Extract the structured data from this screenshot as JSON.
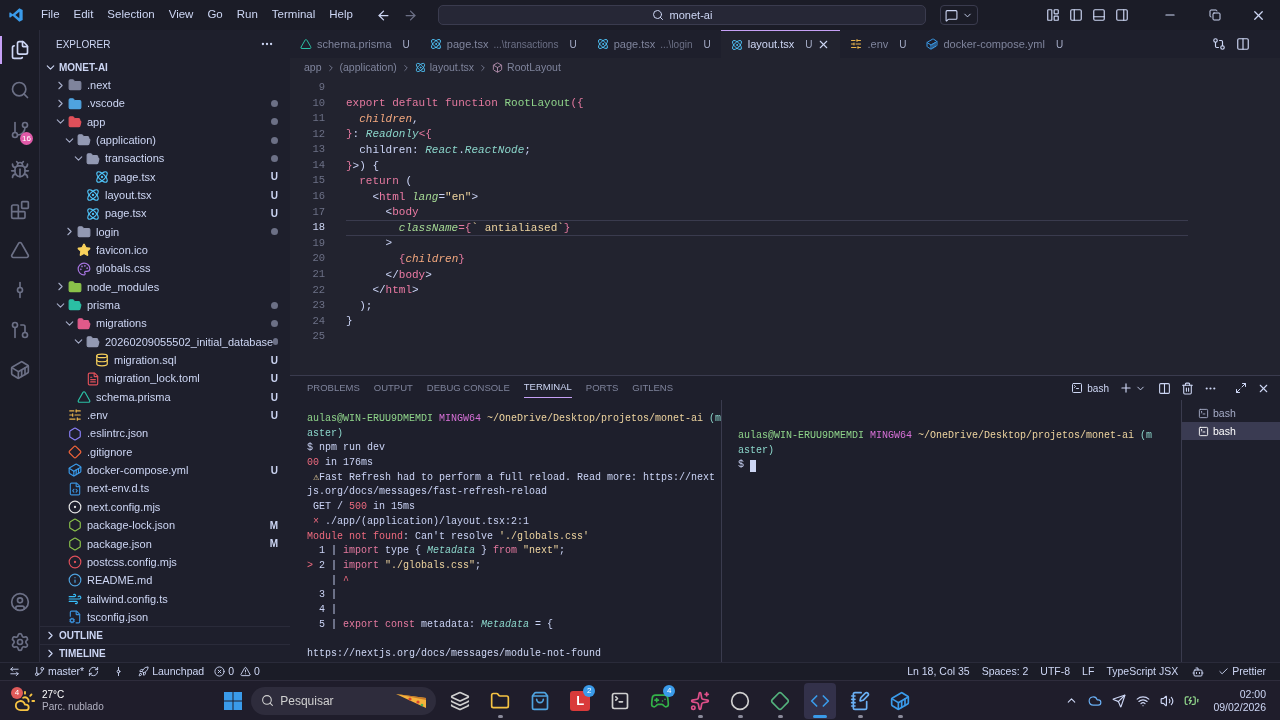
{
  "title_bar": {
    "menu": [
      "File",
      "Edit",
      "Selection",
      "View",
      "Go",
      "Run",
      "Terminal",
      "Help"
    ],
    "search": "monet-ai"
  },
  "activity_bar": {
    "items": [
      {
        "kind": "explorer",
        "selected": true
      },
      {
        "kind": "search",
        "selected": false
      },
      {
        "kind": "source-control",
        "selected": false,
        "badge": "16"
      },
      {
        "kind": "run",
        "selected": false
      },
      {
        "kind": "extensions",
        "selected": false
      },
      {
        "kind": "prisma",
        "selected": false
      },
      {
        "kind": "gitlens",
        "selected": false
      },
      {
        "kind": "remote",
        "selected": false
      },
      {
        "kind": "docker",
        "selected": false
      }
    ],
    "bottom": [
      {
        "kind": "account"
      },
      {
        "kind": "settings"
      }
    ]
  },
  "explorer": {
    "title": "EXPLORER",
    "root": "MONET-AI",
    "tree": [
      {
        "name": ".next",
        "kind": "folder",
        "color": "#7f849c",
        "expanded": false,
        "dot": false
      },
      {
        "name": ".vscode",
        "kind": "folder",
        "color": "#4fa3e0",
        "expanded": false,
        "dot": true
      },
      {
        "name": "app",
        "kind": "folder",
        "color": "#e0505a",
        "expanded": true,
        "dot": true,
        "children": [
          {
            "name": "(application)",
            "kind": "folder",
            "color": "#9399b2",
            "expanded": true,
            "dot": true,
            "children": [
              {
                "name": "transactions",
                "kind": "folder",
                "color": "#9399b2",
                "expanded": true,
                "dot": true,
                "children": [
                  {
                    "name": "page.tsx",
                    "kind": "react",
                    "dot": false,
                    "badge": "U"
                  }
                ]
              },
              {
                "name": "layout.tsx",
                "kind": "react",
                "dot": false,
                "badge": "U"
              },
              {
                "name": "page.tsx",
                "kind": "react",
                "dot": false,
                "badge": "U"
              }
            ]
          },
          {
            "name": "login",
            "kind": "folder",
            "color": "#9399b2",
            "expanded": false,
            "dot": true
          },
          {
            "name": "favicon.ico",
            "kind": "star",
            "dot": false
          },
          {
            "name": "globals.css",
            "kind": "css",
            "dot": false
          }
        ]
      },
      {
        "name": "node_modules",
        "kind": "folder",
        "color": "#8bc34a",
        "expanded": false,
        "dot": false
      },
      {
        "name": "prisma",
        "kind": "folder",
        "color": "#2bbfa4",
        "expanded": true,
        "dot": true,
        "children": [
          {
            "name": "migrations",
            "kind": "folder",
            "color": "#e05a8a",
            "expanded": true,
            "dot": true,
            "children": [
              {
                "name": "20260209055502_initial_database",
                "kind": "folder",
                "color": "#9399b2",
                "expanded": true,
                "dot": true,
                "children": [
                  {
                    "name": "migration.sql",
                    "kind": "sql",
                    "dot": false,
                    "badge": "U"
                  }
                ]
              },
              {
                "name": "migration_lock.toml",
                "kind": "toml",
                "dot": false,
                "badge": "U"
              }
            ]
          },
          {
            "name": "schema.prisma",
            "kind": "prisma",
            "dot": false,
            "badge": "U"
          }
        ]
      },
      {
        "name": ".env",
        "kind": "env",
        "dot": false,
        "badge": "U"
      },
      {
        "name": ".eslintrc.json",
        "kind": "eslint",
        "dot": false
      },
      {
        "name": ".gitignore",
        "kind": "git",
        "dot": false
      },
      {
        "name": "docker-compose.yml",
        "kind": "docker",
        "dot": false,
        "badge": "U"
      },
      {
        "name": "next-env.d.ts",
        "kind": "ts",
        "dot": false
      },
      {
        "name": "next.config.mjs",
        "kind": "next",
        "dot": false
      },
      {
        "name": "package-lock.json",
        "kind": "node",
        "dot": false,
        "badge": "M"
      },
      {
        "name": "package.json",
        "kind": "node",
        "dot": false,
        "badge": "M"
      },
      {
        "name": "postcss.config.mjs",
        "kind": "postcss",
        "dot": false
      },
      {
        "name": "README.md",
        "kind": "info",
        "dot": false
      },
      {
        "name": "tailwind.config.ts",
        "kind": "tailwind",
        "dot": false
      },
      {
        "name": "tsconfig.json",
        "kind": "tsconfig",
        "dot": false
      }
    ],
    "sections": [
      "OUTLINE",
      "TIMELINE"
    ]
  },
  "tabs": [
    {
      "label": "schema.prisma",
      "kind": "prisma",
      "badge": "U",
      "selected": false
    },
    {
      "label": "page.tsx",
      "hint": "...\\transactions",
      "kind": "react",
      "badge": "U",
      "selected": false
    },
    {
      "label": "page.tsx",
      "hint": "...\\login",
      "kind": "react",
      "badge": "U",
      "selected": false
    },
    {
      "label": "layout.tsx",
      "kind": "react",
      "badge": "U",
      "selected": true
    },
    {
      "label": ".env",
      "kind": "env",
      "badge": "U",
      "selected": false
    },
    {
      "label": "docker-compose.yml",
      "kind": "docker",
      "badge": "U",
      "selected": false
    }
  ],
  "breadcrumbs": [
    {
      "text": "app",
      "kind": "folder"
    },
    {
      "text": "(application)",
      "kind": "folder"
    },
    {
      "text": "layout.tsx",
      "kind": "react"
    },
    {
      "text": "RootLayout",
      "kind": "symbol"
    }
  ],
  "code": [
    {
      "n": "9",
      "current": false
    },
    {
      "n": "10",
      "current": false,
      "tokens": [
        {
          "t": "export default function",
          "kind": "kw"
        },
        {
          "t": " RootLayout",
          "kind": "fn"
        },
        {
          "t": "({",
          "kind": "brace"
        }
      ]
    },
    {
      "n": "11",
      "current": false,
      "tokens": [
        {
          "t": "  children",
          "kind": "param"
        },
        {
          "t": ",",
          "kind": "plain"
        }
      ]
    },
    {
      "n": "12",
      "current": false,
      "tokens": [
        {
          "t": "}",
          "kind": "brace"
        },
        {
          "t": ": ",
          "kind": "plain"
        },
        {
          "t": "Readonly",
          "kind": "type"
        },
        {
          "t": "<{",
          "kind": "brace"
        }
      ]
    },
    {
      "n": "13",
      "current": false,
      "tokens": [
        {
          "t": "  children: ",
          "kind": "plain"
        },
        {
          "t": "React",
          "kind": "type"
        },
        {
          "t": ".",
          "kind": "plain"
        },
        {
          "t": "ReactNode",
          "kind": "type"
        },
        {
          "t": ";",
          "kind": "plain"
        }
      ]
    },
    {
      "n": "14",
      "current": false,
      "tokens": [
        {
          "t": "}",
          "kind": "brace"
        },
        {
          "t": ">) {",
          "kind": "plain"
        }
      ]
    },
    {
      "n": "15",
      "current": false,
      "tokens": [
        {
          "t": "  return",
          "kind": "kw"
        },
        {
          "t": " (",
          "kind": "plain"
        }
      ]
    },
    {
      "n": "16",
      "current": false,
      "tokens": [
        {
          "t": "    <",
          "kind": "plain"
        },
        {
          "t": "html",
          "kind": "tag"
        },
        {
          "t": " lang",
          "kind": "attr"
        },
        {
          "t": "=",
          "kind": "plain"
        },
        {
          "t": "\"en\"",
          "kind": "str"
        },
        {
          "t": ">",
          "kind": "plain"
        }
      ]
    },
    {
      "n": "17",
      "current": false,
      "tokens": [
        {
          "t": "      <",
          "kind": "plain"
        },
        {
          "t": "body",
          "kind": "tag"
        }
      ]
    },
    {
      "n": "18",
      "current": true,
      "tokens": [
        {
          "t": "        className",
          "kind": "attr"
        },
        {
          "t": "=",
          "kind": "kw"
        },
        {
          "t": "{",
          "kind": "brace"
        },
        {
          "t": "` antialiased`",
          "kind": "str"
        },
        {
          "t": "}",
          "kind": "brace"
        }
      ]
    },
    {
      "n": "19",
      "current": false,
      "tokens": [
        {
          "t": "      >",
          "kind": "plain"
        }
      ]
    },
    {
      "n": "20",
      "current": false,
      "tokens": [
        {
          "t": "        {",
          "kind": "brace"
        },
        {
          "t": "children",
          "kind": "param"
        },
        {
          "t": "}",
          "kind": "brace"
        }
      ]
    },
    {
      "n": "21",
      "current": false,
      "tokens": [
        {
          "t": "      </",
          "kind": "plain"
        },
        {
          "t": "body",
          "kind": "tag"
        },
        {
          "t": ">",
          "kind": "plain"
        }
      ]
    },
    {
      "n": "22",
      "current": false,
      "tokens": [
        {
          "t": "    </",
          "kind": "plain"
        },
        {
          "t": "html",
          "kind": "tag"
        },
        {
          "t": ">",
          "kind": "plain"
        }
      ]
    },
    {
      "n": "23",
      "current": false,
      "tokens": [
        {
          "t": "  );",
          "kind": "plain"
        }
      ]
    },
    {
      "n": "24",
      "current": false,
      "tokens": [
        {
          "t": "}",
          "kind": "plain"
        }
      ]
    },
    {
      "n": "25",
      "current": false
    }
  ],
  "panel": {
    "tabs": [
      {
        "label": "PROBLEMS",
        "selected": false
      },
      {
        "label": "OUTPUT",
        "selected": false
      },
      {
        "label": "DEBUG CONSOLE",
        "selected": false
      },
      {
        "label": "TERMINAL",
        "selected": true
      },
      {
        "label": "PORTS",
        "selected": false
      },
      {
        "label": "GITLENS",
        "selected": false
      }
    ],
    "shell": "bash",
    "terminal_left": [
      [
        {
          "t": "aulas@WIN-ERUU9DMEMDI",
          "kind": "user"
        },
        {
          "t": " MINGW64",
          "kind": "host"
        },
        {
          "t": " ~/OneDrive/Desktop/projetos/monet-ai",
          "kind": "path"
        },
        {
          "t": " (m",
          "kind": "branch"
        }
      ],
      [
        {
          "t": "aster)",
          "kind": "branch"
        }
      ],
      [
        {
          "t": "$ npm run dev",
          "kind": "plain"
        }
      ],
      [
        {
          "t": "00",
          "kind": "err"
        },
        {
          "t": " in 176ms",
          "kind": "plain"
        }
      ],
      [
        {
          "t": " ⚠",
          "kind": "warn"
        },
        {
          "t": "Fast Refresh had to perform a full reload. Read more: https://next",
          "kind": "plain"
        }
      ],
      [
        {
          "t": "js.org/docs/messages/fast-refresh-reload",
          "kind": "plain"
        }
      ],
      [
        {
          "t": " GET / ",
          "kind": "plain"
        },
        {
          "t": "500",
          "kind": "err"
        },
        {
          "t": " in 15ms",
          "kind": "plain"
        }
      ],
      [
        {
          "t": " ×",
          "kind": "err"
        },
        {
          "t": " ./app/(application)/layout.tsx:2:1",
          "kind": "plain"
        }
      ],
      [
        {
          "t": "Module not found",
          "kind": "err"
        },
        {
          "t": ": Can't resolve ",
          "kind": "plain"
        },
        {
          "t": "'./globals.css'",
          "kind": "str"
        }
      ],
      [
        {
          "t": "  1 | ",
          "kind": "plain"
        },
        {
          "t": "import",
          "kind": "kw"
        },
        {
          "t": " type { ",
          "kind": "plain"
        },
        {
          "t": "Metadata",
          "kind": "type"
        },
        {
          "t": " } ",
          "kind": "plain"
        },
        {
          "t": "from",
          "kind": "kw"
        },
        {
          "t": " \"next\"",
          "kind": "str"
        },
        {
          "t": ";",
          "kind": "plain"
        }
      ],
      [
        {
          "t": "> ",
          "kind": "err"
        },
        {
          "t": "2 | ",
          "kind": "plain"
        },
        {
          "t": "import",
          "kind": "kw"
        },
        {
          "t": " \"./globals.css\"",
          "kind": "str"
        },
        {
          "t": ";",
          "kind": "plain"
        }
      ],
      [
        {
          "t": "    | ",
          "kind": "plain"
        },
        {
          "t": "^",
          "kind": "err"
        }
      ],
      [
        {
          "t": "  3 |",
          "kind": "plain"
        }
      ],
      [
        {
          "t": "  4 |",
          "kind": "plain"
        }
      ],
      [
        {
          "t": "  5 | ",
          "kind": "plain"
        },
        {
          "t": "export const",
          "kind": "kw"
        },
        {
          "t": " metadata: ",
          "kind": "plain"
        },
        {
          "t": "Metadata",
          "kind": "type"
        },
        {
          "t": " = {",
          "kind": "plain"
        }
      ]
    ],
    "help_link": "https://nextjs.org/docs/messages/module-not-found",
    "terminal_right": [
      [
        {
          "t": "aulas@WIN-ERUU9DMEMDI",
          "kind": "user"
        },
        {
          "t": " MINGW64",
          "kind": "host"
        },
        {
          "t": " ~/OneDrive/Desktop/projetos/monet-ai",
          "kind": "path"
        },
        {
          "t": " (m",
          "kind": "branch"
        }
      ],
      [
        {
          "t": "aster)",
          "kind": "branch"
        }
      ],
      [
        {
          "t": "$",
          "kind": "plain"
        }
      ]
    ],
    "cursor": true,
    "instances": [
      {
        "label": "bash",
        "selected": false
      },
      {
        "label": "bash",
        "selected": true
      }
    ]
  },
  "status_bar": {
    "branch": "master*",
    "launchpad": "Launchpad",
    "errors": "0",
    "warnings": "0",
    "right": [
      "Ln 18, Col 35",
      "Spaces: 2",
      "UTF-8",
      "LF",
      "TypeScript JSX"
    ],
    "prettier": "Prettier"
  },
  "taskbar": {
    "weather": {
      "temp": "27°C",
      "text": "Parc. nublado",
      "badge": "4"
    },
    "search": "Pesquisar",
    "apps": [
      {
        "kind": "taskview",
        "open": false,
        "focused": false
      },
      {
        "kind": "files",
        "open": true,
        "focused": false
      },
      {
        "kind": "store",
        "open": false,
        "focused": false
      },
      {
        "kind": "letter",
        "label": "L",
        "badge": "2",
        "open": false,
        "focused": false
      },
      {
        "kind": "terminal",
        "open": false,
        "focused": false
      },
      {
        "kind": "xbox",
        "badge": "4",
        "open": false,
        "focused": false
      },
      {
        "kind": "paint",
        "open": true,
        "focused": false
      },
      {
        "kind": "obs",
        "open": true,
        "focused": false
      },
      {
        "kind": "git",
        "open": true,
        "focused": false
      },
      {
        "kind": "vscode",
        "open": true,
        "focused": true
      },
      {
        "kind": "notepad",
        "open": true,
        "focused": false
      },
      {
        "kind": "docker",
        "open": true,
        "focused": false
      }
    ],
    "time": "02:00",
    "date": "09/02/2026"
  }
}
